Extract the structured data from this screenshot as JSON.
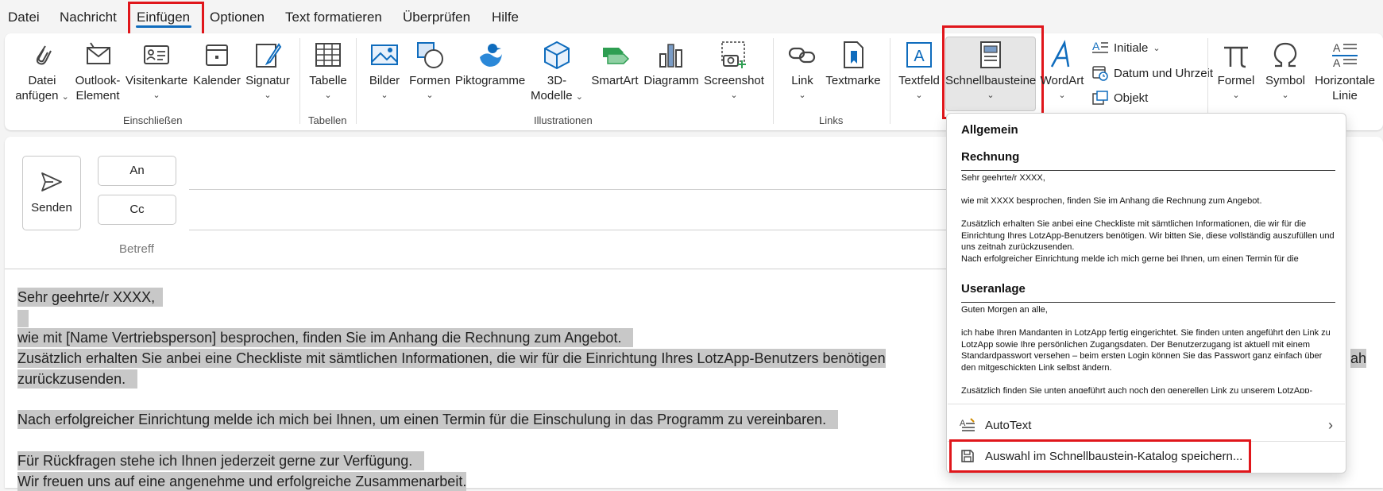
{
  "menu_tabs": [
    "Datei",
    "Nachricht",
    "Einfügen",
    "Optionen",
    "Text formatieren",
    "Überprüfen",
    "Hilfe"
  ],
  "active_tab": "Einfügen",
  "ribbon": {
    "datei_anfuegen": [
      "Datei",
      "anfügen"
    ],
    "outlook_element": [
      "Outlook-",
      "Element"
    ],
    "visitenkarte": "Visitenkarte",
    "kalender": "Kalender",
    "signatur": "Signatur",
    "tabelle": "Tabelle",
    "bilder": "Bilder",
    "formen": "Formen",
    "piktogramme": "Piktogramme",
    "modelle_3d": [
      "3D-",
      "Modelle"
    ],
    "smartart": "SmartArt",
    "diagramm": "Diagramm",
    "screenshot": "Screenshot",
    "link": "Link",
    "textmarke": "Textmarke",
    "textfeld": "Textfeld",
    "schnellbausteine": "Schnellbausteine",
    "wordart": "WordArt",
    "initiale": "Initiale",
    "datum_uhrzeit": "Datum und Uhrzeit",
    "objekt": "Objekt",
    "formel": "Formel",
    "symbol": "Symbol",
    "horizontale_linie": [
      "Horizontale",
      "Linie"
    ],
    "groups": {
      "einschliessen": "Einschließen",
      "tabellen": "Tabellen",
      "illustrationen": "Illustrationen",
      "links": "Links"
    }
  },
  "compose": {
    "send": "Senden",
    "to": "An",
    "cc": "Cc",
    "subject_label": "Betreff"
  },
  "body_lines": [
    "Sehr geehrte/r XXXX,",
    "wie mit [Name Vertriebsperson] besprochen, finden Sie im Anhang die Rechnung zum Angebot.",
    "Zusätzlich erhalten Sie anbei eine Checkliste mit sämtlichen Informationen, die wir für die Einrichtung Ihres LotzApp-Benutzers benötigen",
    "ah",
    "zurückzusenden.",
    "Nach erfolgreicher Einrichtung melde ich mich bei Ihnen, um einen Termin für die Einschulung in das Programm zu vereinbaren.",
    "Für Rückfragen stehe ich Ihnen jederzeit gerne zur Verfügung.",
    "Wir freuen uns auf eine angenehme und erfolgreiche Zusammenarbeit."
  ],
  "dropdown": {
    "section_general": "Allgemein",
    "entry1_title": "Rechnung",
    "entry1_lines": [
      "Sehr geehrte/r XXXX,",
      "wie mit XXXX besprochen, finden Sie im Anhang die Rechnung zum Angebot.",
      "Zusätzlich erhalten Sie anbei eine Checkliste mit sämtlichen Informationen, die wir für die Einrichtung Ihres LotzApp-Benutzers benötigen. Wir bitten Sie, diese vollständig auszufüllen und uns zeitnah zurückzusenden.",
      "Nach erfolgreicher Einrichtung melde ich mich gerne bei Ihnen, um einen Termin für die"
    ],
    "entry2_title": "Useranlage",
    "entry2_lines": [
      "Guten Morgen an alle,",
      "ich habe Ihren Mandanten in LotzApp fertig eingerichtet. Sie finden unten angeführt den Link zu LotzApp sowie Ihre persönlichen Zugangsdaten. Der Benutzerzugang ist aktuell mit einem Standardpasswort versehen – beim ersten Login können Sie das Passwort ganz einfach über den mitgeschickten Link selbst ändern.",
      "Zusätzlich finden Sie unten angeführt auch noch den generellen Link zu unserem LotzApp-"
    ],
    "autotext": "AutoText",
    "save_selection": "Auswahl im Schnellbaustein-Katalog speichern..."
  },
  "colors": {
    "accent": "#0f6cbd",
    "highlight_box": "#e0161b",
    "selection": "#c8c8c8"
  }
}
